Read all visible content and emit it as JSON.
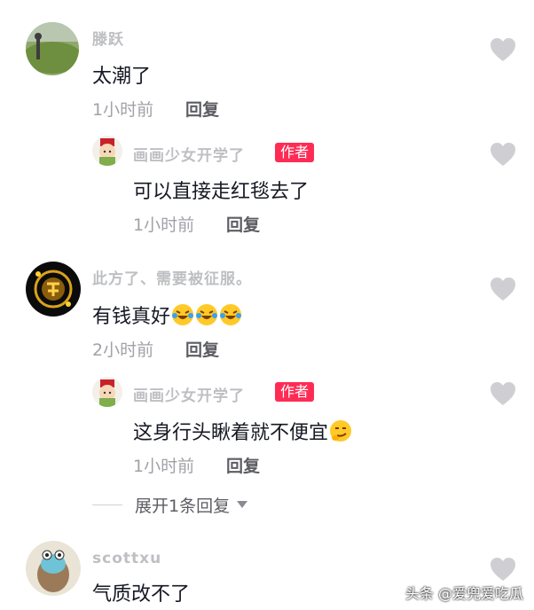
{
  "comments": [
    {
      "username": "滕跃",
      "text": "太潮了",
      "time": "1小时前",
      "reply_label": "回复",
      "avatar_icon": "grass-field-avatar"
    },
    {
      "username": "画画少女开学了",
      "badge": "作者",
      "text": "可以直接走红毯去了",
      "time": "1小时前",
      "reply_label": "回复",
      "avatar_icon": "cartoon-girl-avatar"
    },
    {
      "username": "此方了、需要被征服。",
      "text": "有钱真好",
      "time": "2小时前",
      "reply_label": "回复",
      "avatar_icon": "gold-emblem-avatar"
    },
    {
      "username": "画画少女开学了",
      "badge": "作者",
      "text": "这身行头瞅着就不便宜",
      "time": "1小时前",
      "reply_label": "回复",
      "avatar_icon": "cartoon-girl-avatar"
    },
    {
      "username": "scottxu",
      "text": "气质改不了",
      "avatar_icon": "cartoon-creature-avatar"
    }
  ],
  "expand_replies_label": "展开1条回复",
  "watermark": "头条 @爱兜爱吃瓜",
  "colors": {
    "accent": "#fe2c55",
    "heart": "#cfcfd3",
    "muted": "#a1a2a7"
  }
}
